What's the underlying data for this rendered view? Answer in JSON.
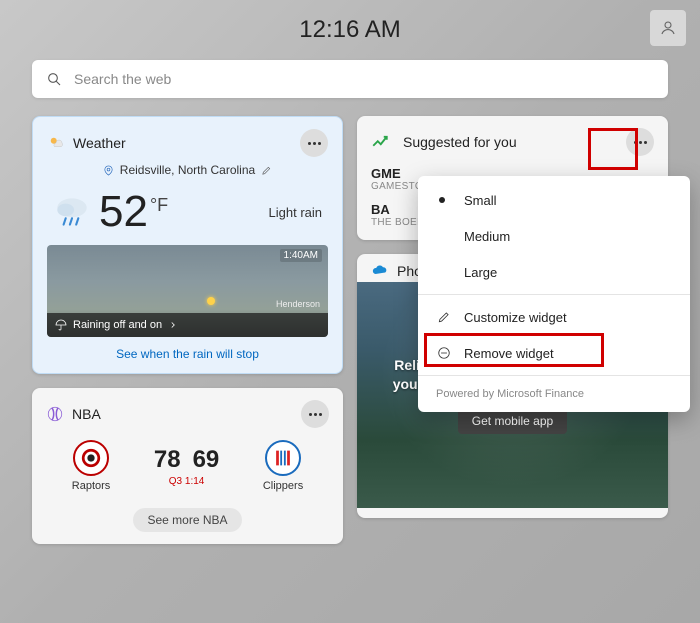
{
  "header": {
    "time": "12:16 AM"
  },
  "search": {
    "placeholder": "Search the web"
  },
  "weather": {
    "title": "Weather",
    "location": "Reidsville, North Carolina",
    "temp": "52",
    "unit": "°F",
    "condition": "Light rain",
    "map_time": "1:40AM",
    "map_city": "Henderson",
    "map_caption": "Raining off and on",
    "link": "See when the rain will stop"
  },
  "nba": {
    "title": "NBA",
    "team_a": "Raptors",
    "team_b": "Clippers",
    "score_a": "78",
    "score_b": "69",
    "period": "Q3 1:14",
    "more": "See more NBA"
  },
  "suggested": {
    "title": "Suggested for you",
    "stocks": [
      {
        "sym": "GME",
        "name": "GAMESTO"
      },
      {
        "sym": "BA",
        "name": "THE BOEIN"
      }
    ]
  },
  "photos": {
    "title": "Photos",
    "text": "Relive your memories by uploading your photos from the OneDrive app.",
    "button": "Get mobile app"
  },
  "menu": {
    "small": "Small",
    "medium": "Medium",
    "large": "Large",
    "customize": "Customize widget",
    "remove": "Remove widget",
    "footer": "Powered by Microsoft Finance"
  }
}
